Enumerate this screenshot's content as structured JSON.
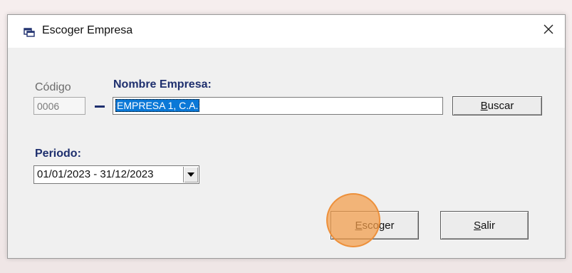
{
  "window": {
    "title": "Escoger Empresa",
    "close_symbol": "×"
  },
  "form": {
    "codigo_label": "Código",
    "codigo_value": "0006",
    "nombre_label": "Nombre Empresa:",
    "nombre_value": "EMPRESA 1, C.A.",
    "periodo_label": "Periodo:",
    "periodo_value": "01/01/2023 - 31/12/2023"
  },
  "buttons": {
    "buscar": {
      "mnemonic": "B",
      "rest": "uscar"
    },
    "escoger": {
      "mnemonic": "E",
      "rest": "scoger"
    },
    "salir": {
      "mnemonic": "S",
      "rest": "alir"
    }
  },
  "icons": {
    "app": "window-app-icon",
    "close": "close-icon",
    "dropdown": "chevron-down-icon"
  },
  "colors": {
    "label_accent": "#1e2f6e",
    "selection": "#0a78d7",
    "click_highlight": "#f39c4a"
  }
}
